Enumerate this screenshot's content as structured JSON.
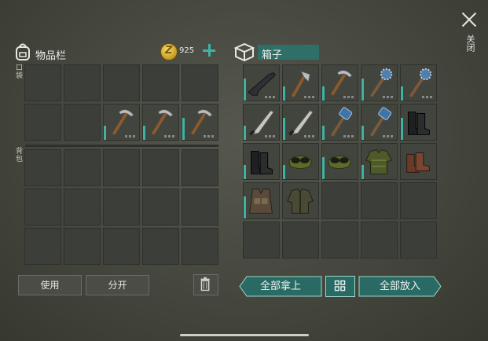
{
  "close_label": "关闭",
  "inventory": {
    "title": "物品栏",
    "coins": "925",
    "pocket_label": "口袋",
    "backpack_label": "背包",
    "pocket_slots": [
      "",
      "",
      "",
      "",
      "",
      "",
      "",
      "pickaxe",
      "pickaxe",
      "pickaxe"
    ],
    "backpack_slots": [
      "",
      "",
      "",
      "",
      "",
      "",
      "",
      "",
      "",
      "",
      "",
      "",
      "",
      "",
      ""
    ],
    "use_button": "使用",
    "split_button": "分开"
  },
  "chest": {
    "title": "箱子",
    "slots": [
      "rifle",
      "hatchet",
      "pickaxe",
      "spiked-mace",
      "spiked-mace",
      "machete",
      "machete",
      "sledgehammer",
      "sledgehammer",
      "boots",
      "boots",
      "goggles",
      "goggles",
      "jacket",
      "boots-brown",
      "vest",
      "jacket-green",
      "",
      "",
      "",
      "",
      "",
      "",
      "",
      ""
    ],
    "take_all_button": "全部拿上",
    "put_all_button": "全部放入"
  },
  "colors": {
    "accent": "#3fb3a3",
    "teal_button": "#2a6a64"
  }
}
